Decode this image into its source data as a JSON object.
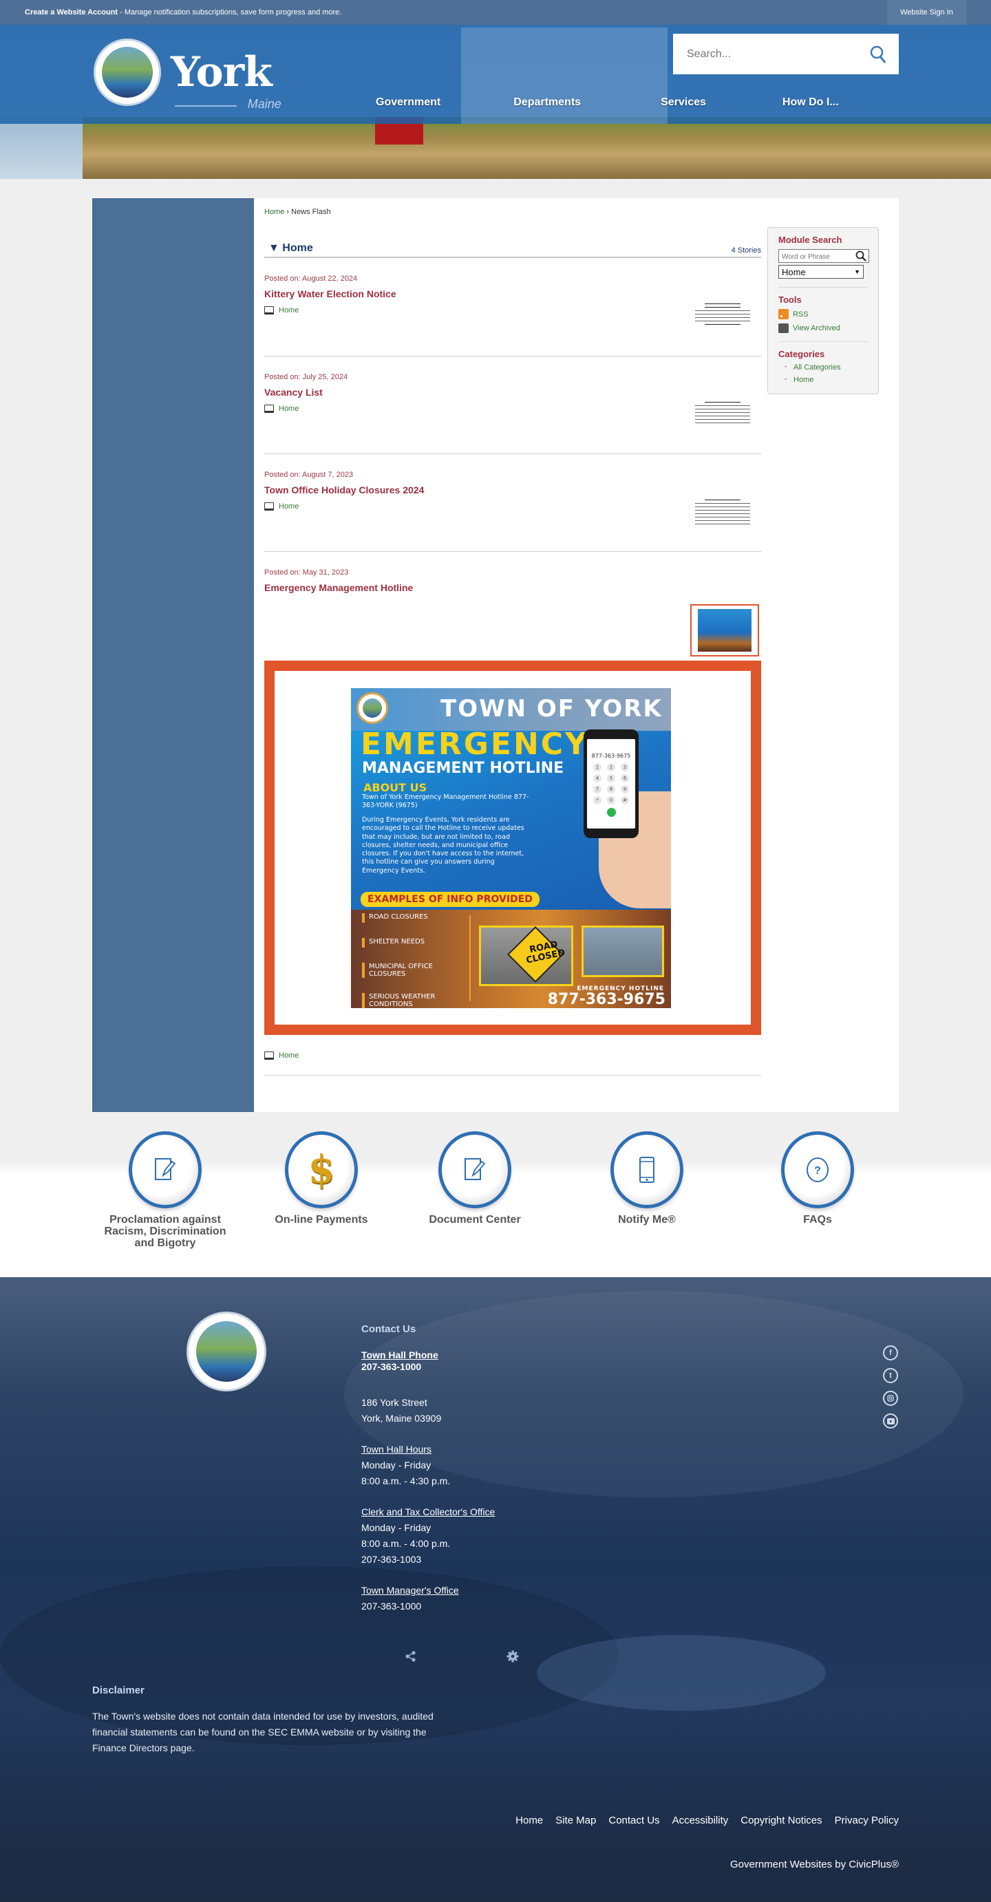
{
  "topbar": {
    "account_bold": "Create a Website Account",
    "account_rest": " - Manage notification subscriptions, save form progress and more.",
    "signin": "Website Sign In"
  },
  "header": {
    "brand_name": "York",
    "brand_sub": "Maine",
    "search_placeholder": "Search...",
    "nav": [
      "Government",
      "Departments",
      "Services",
      "How Do I..."
    ]
  },
  "breadcrumb": {
    "home": "Home",
    "separator": " › ",
    "current": "News Flash"
  },
  "category": {
    "title": "Home",
    "toggle_glyph": "▼",
    "count": "4 Stories"
  },
  "stories": [
    {
      "date": "Posted on: August 22, 2024",
      "title": "Kittery Water Election Notice",
      "category": "Home"
    },
    {
      "date": "Posted on: July 25, 2024",
      "title": "Vacancy List",
      "category": "Home"
    },
    {
      "date": "Posted on: August 7, 2023",
      "title": "Town Office Holiday Closures 2024",
      "category": "Home"
    },
    {
      "date": "Posted on: May 31, 2023",
      "title": "Emergency Management Hotline",
      "category": "Home"
    }
  ],
  "flyer": {
    "town": "TOWN OF YORK",
    "emergency": "EMERGENCY",
    "management": "MANAGEMENT HOTLINE",
    "about": "ABOUT US",
    "hotline_line": "Town of York Emergency Management Hotline 877-363-YORK (9675)",
    "body": "During Emergency Events, York residents are encouraged to call the Hotline to receive updates that may include, but are not limited to, road closures, shelter needs, and municipal office closures. If you don't have access to the internet, this hotline can give you answers during Emergency Events.",
    "examples": "EXAMPLES OF INFO PROVIDED",
    "list": [
      "ROAD CLOSURES",
      "SHELTER NEEDS",
      "MUNICIPAL OFFICE CLOSURES",
      "SERIOUS WEATHER CONDITIONS"
    ],
    "road_sign": "ROAD CLOSED",
    "phone_screen": "877-363-9675",
    "hotline_label": "EMERGENCY HOTLINE",
    "hotline_number": "877-363-9675",
    "keys": [
      "1",
      "2",
      "3",
      "4",
      "5",
      "6",
      "7",
      "8",
      "9",
      "*",
      "0",
      "#"
    ]
  },
  "module": {
    "search_title": "Module Search",
    "search_placeholder": "Word or Phrase",
    "select_value": "Home",
    "tools_title": "Tools",
    "tools": [
      "RSS",
      "View Archived"
    ],
    "categories_title": "Categories",
    "categories": [
      "All Categories",
      "Home"
    ]
  },
  "quicklinks": [
    {
      "label": "Proclamation against Racism, Discrimination and Bigotry",
      "icon": "document-edit-icon"
    },
    {
      "label": "On-line Payments",
      "icon": "dollar-icon"
    },
    {
      "label": "Document Center",
      "icon": "document-edit-icon"
    },
    {
      "label": "Notify Me®",
      "icon": "mobile-phone-icon"
    },
    {
      "label": "FAQs",
      "icon": "question-icon"
    }
  ],
  "footer": {
    "contact_title": "Contact Us",
    "town_hall_phone_label": "Town Hall Phone",
    "town_hall_phone": "207-363-1000",
    "address1": "186 York Street",
    "address2": "York, Maine 03909",
    "hours_label": "Town Hall Hours",
    "hours_days": "Monday - Friday",
    "hours_time": "8:00 a.m. - 4:30 p.m.",
    "clerk_label": "Clerk and Tax Collector's Office",
    "clerk_days": "Monday - Friday",
    "clerk_time": "8:00 a.m. - 4:00 p.m.",
    "clerk_phone": "207-363-1003",
    "manager_label": "Town Manager's Office",
    "manager_phone": "207-363-1000",
    "social": [
      "facebook",
      "twitter",
      "instagram",
      "youtube"
    ],
    "disclaimer_title": "Disclaimer",
    "disclaimer_text": "The Town's website does not contain data intended for use by investors, audited financial statements can be found on the SEC EMMA website or by visiting the Finance Directors page.",
    "links": [
      "Home",
      "Site Map",
      "Contact Us",
      "Accessibility",
      "Copyright Notices",
      "Privacy Policy"
    ],
    "civicplus": "Government Websites by CivicPlus®"
  }
}
